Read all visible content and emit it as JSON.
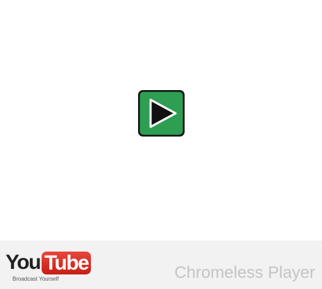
{
  "player": {
    "play_button_icon": "play-icon",
    "play_button_color": "#2e9e52"
  },
  "footer": {
    "logo": {
      "you": "You",
      "tube": "Tube",
      "tagline": "Broadcast Yourself",
      "tube_color": "#d42a20"
    },
    "title": "Chromeless Player"
  }
}
